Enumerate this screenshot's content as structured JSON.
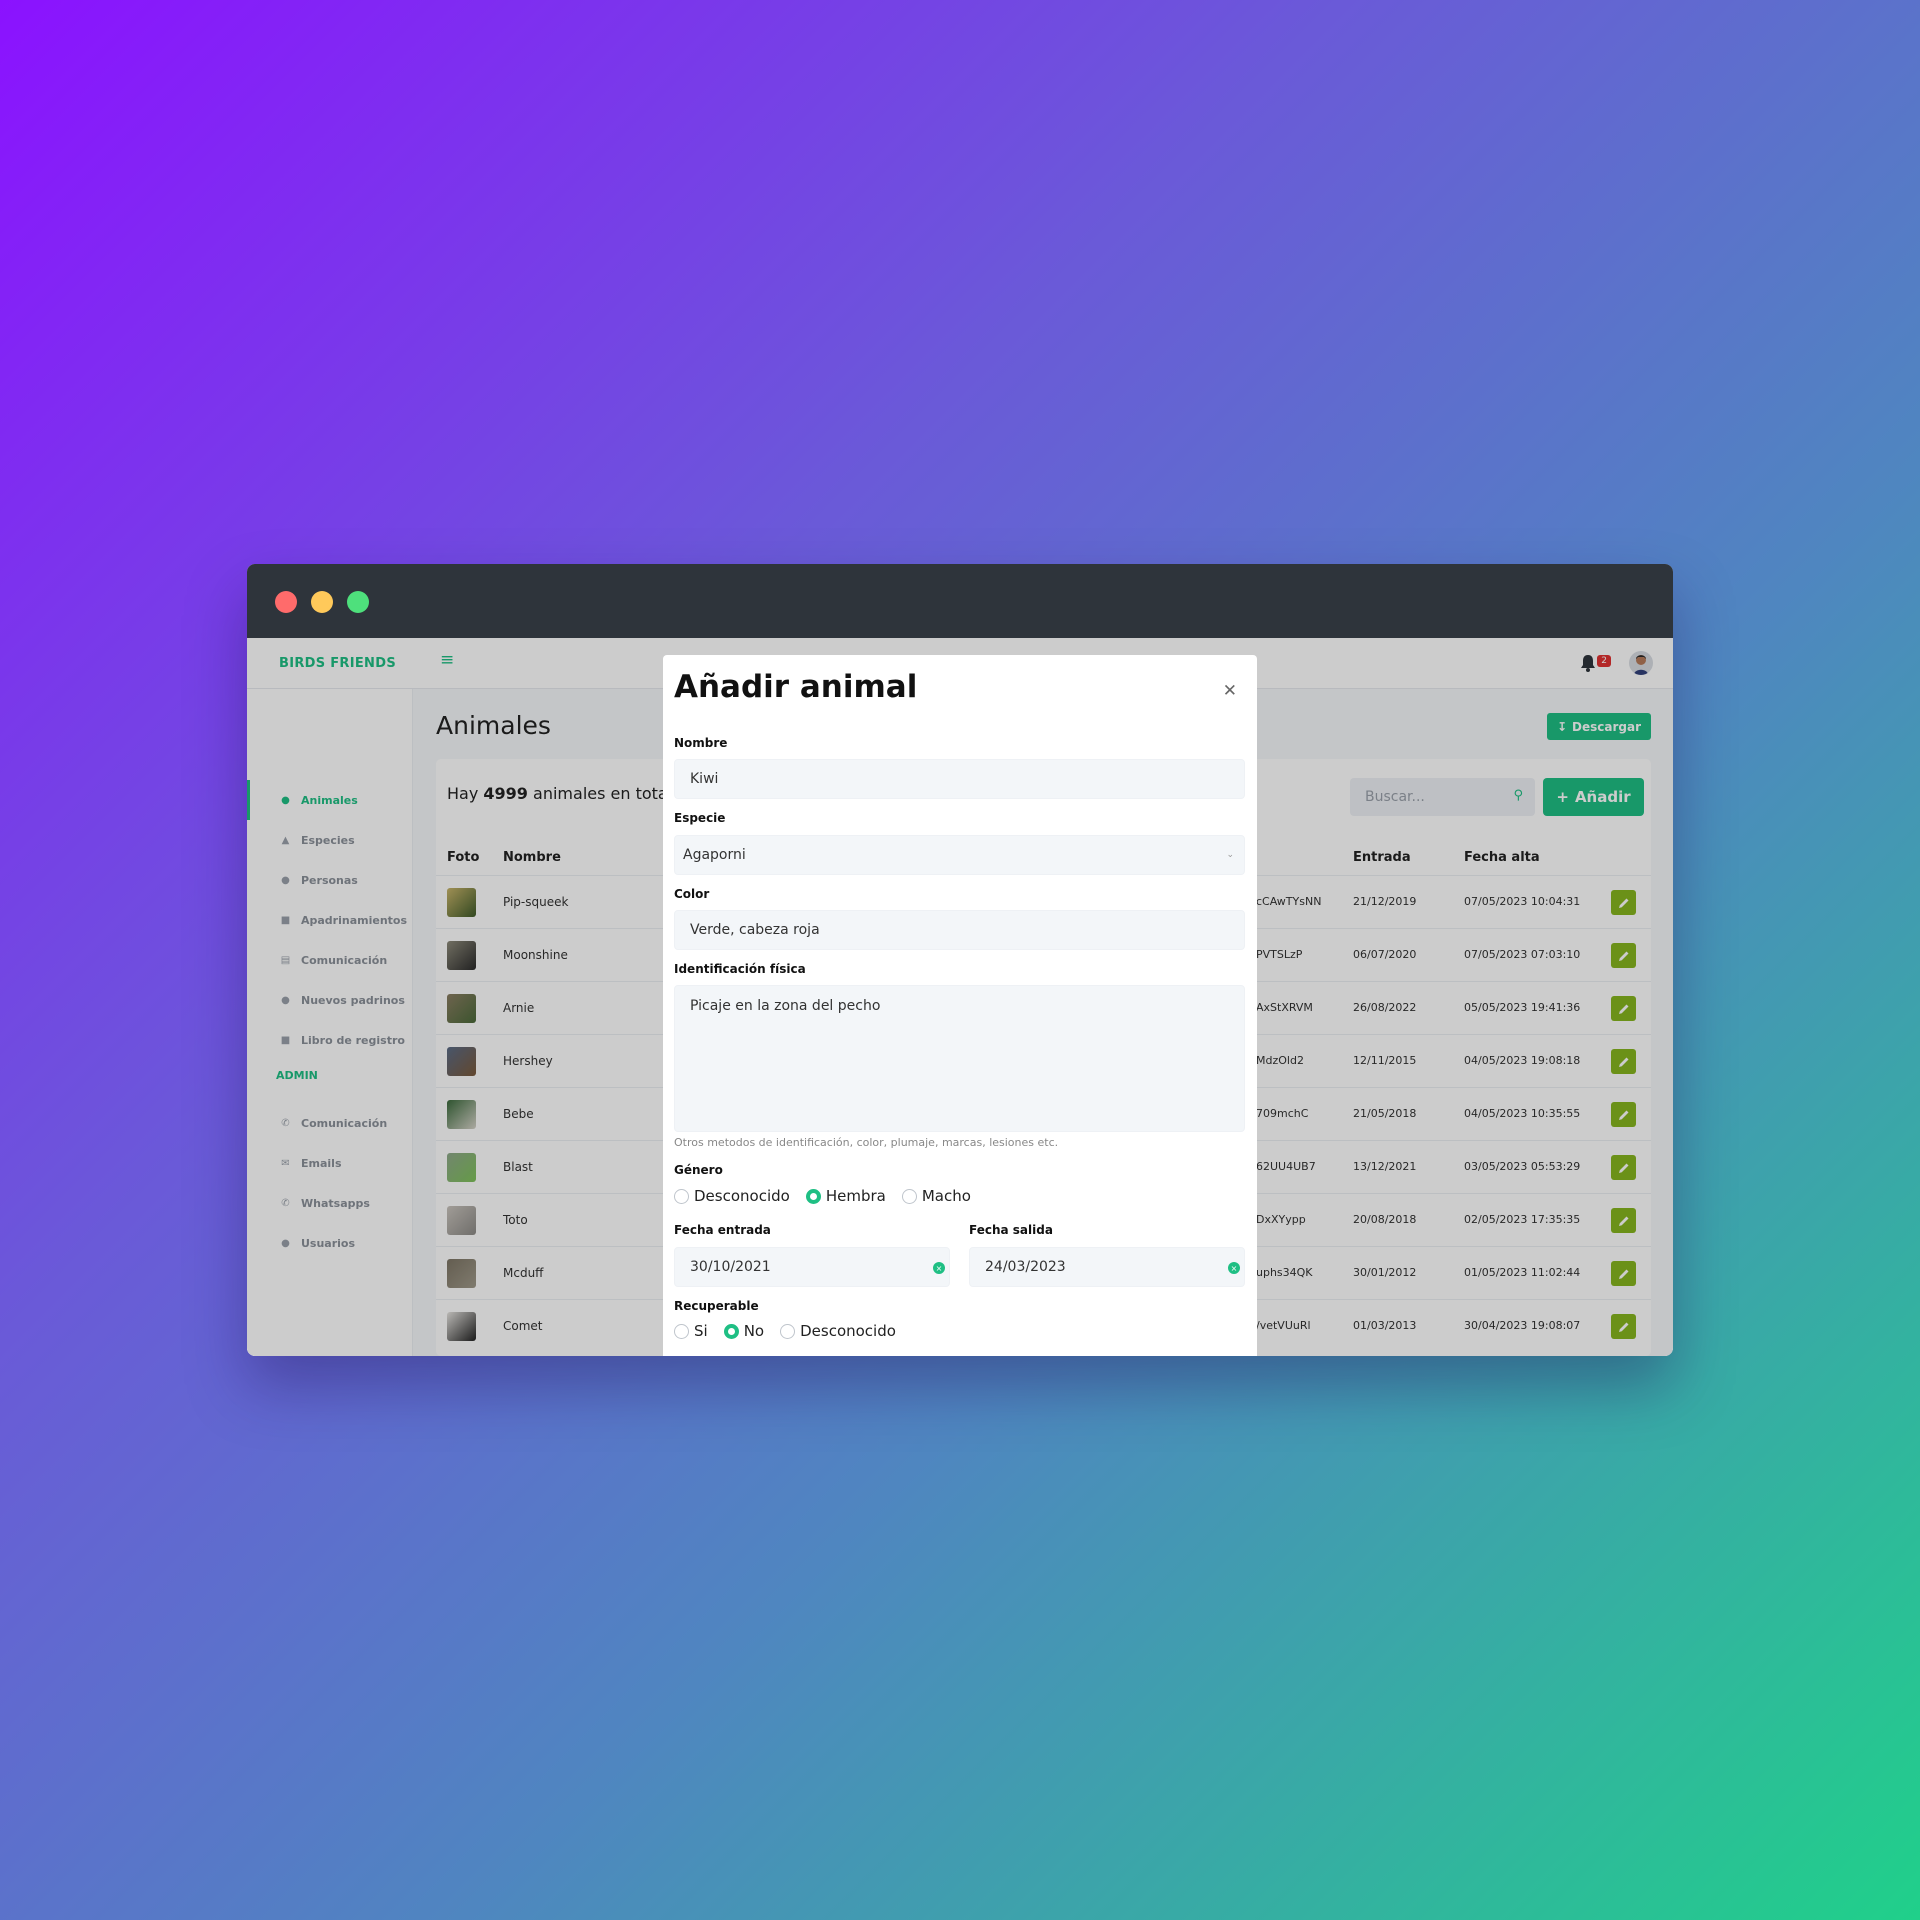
{
  "app": {
    "brand": "BIRDS FRIENDS",
    "notifications": "2"
  },
  "sidebar": {
    "items": [
      {
        "label": "Animales",
        "icon": "paw-icon"
      },
      {
        "label": "Especies",
        "icon": "bullhorn-icon"
      },
      {
        "label": "Personas",
        "icon": "users-icon"
      },
      {
        "label": "Apadrinamientos",
        "icon": "file-icon"
      },
      {
        "label": "Comunicación",
        "icon": "signs-icon"
      },
      {
        "label": "Nuevos padrinos",
        "icon": "users-icon"
      },
      {
        "label": "Libro de registro",
        "icon": "book-icon"
      }
    ],
    "admin_label": "ADMIN",
    "admin_items": [
      {
        "label": "Comunicación",
        "icon": "phone-icon"
      },
      {
        "label": "Emails",
        "icon": "envelope-icon"
      },
      {
        "label": "Whatsapps",
        "icon": "phone-icon"
      },
      {
        "label": "Usuarios",
        "icon": "users-icon"
      }
    ]
  },
  "page": {
    "title": "Animales",
    "download_label": "Descargar",
    "total_prefix": "Hay",
    "total_count": "4999",
    "total_suffix": "animales en total",
    "search_placeholder": "Buscar...",
    "add_label": "Añadir"
  },
  "table": {
    "headers": {
      "foto": "Foto",
      "nombre": "Nombre",
      "entrada": "Entrada",
      "alta": "Fecha alta"
    },
    "rows": [
      {
        "name": "Pip-squeek",
        "code": "cCAwTYsNN",
        "entry": "21/12/2019",
        "alta": "07/05/2023 10:04:31"
      },
      {
        "name": "Moonshine",
        "code": "PVTSLzP",
        "entry": "06/07/2020",
        "alta": "07/05/2023 07:03:10"
      },
      {
        "name": "Arnie",
        "code": "AxStXRVM",
        "entry": "26/08/2022",
        "alta": "05/05/2023 19:41:36"
      },
      {
        "name": "Hershey",
        "code": "MdzOld2",
        "entry": "12/11/2015",
        "alta": "04/05/2023 19:08:18"
      },
      {
        "name": "Bebe",
        "code": "709mchC",
        "entry": "21/05/2018",
        "alta": "04/05/2023 10:35:55"
      },
      {
        "name": "Blast",
        "code": "62UU4UB7",
        "entry": "13/12/2021",
        "alta": "03/05/2023 05:53:29"
      },
      {
        "name": "Toto",
        "code": "DxXYypp",
        "entry": "20/08/2018",
        "alta": "02/05/2023 17:35:35"
      },
      {
        "name": "Mcduff",
        "code": "uphs34QK",
        "entry": "30/01/2012",
        "alta": "01/05/2023 11:02:44"
      },
      {
        "name": "Comet",
        "code": "/vetVUuRl",
        "entry": "01/03/2013",
        "alta": "30/04/2023 19:08:07"
      }
    ]
  },
  "modal": {
    "title": "Añadir animal",
    "nombre_label": "Nombre",
    "nombre_value": "Kiwi",
    "especie_label": "Especie",
    "especie_value": "Agaporni",
    "color_label": "Color",
    "color_value": "Verde, cabeza roja",
    "ident_label": "Identificación física",
    "ident_value": "Picaje en la zona del pecho",
    "ident_help": "Otros metodos de identificación, color, plumaje, marcas, lesiones etc.",
    "genero_label": "Género",
    "genero_options": [
      "Desconocido",
      "Hembra",
      "Macho"
    ],
    "genero_selected": "Hembra",
    "fecha_entrada_label": "Fecha entrada",
    "fecha_entrada_value": "30/10/2021",
    "fecha_salida_label": "Fecha salida",
    "fecha_salida_value": "24/03/2023",
    "recuperable_label": "Recuperable",
    "recuperable_options": [
      "Si",
      "No",
      "Desconocido"
    ],
    "recuperable_selected": "No"
  },
  "colors": {
    "accent": "#1fbf84",
    "edit_button": "#86b61f",
    "titlebar": "#2e343b"
  }
}
